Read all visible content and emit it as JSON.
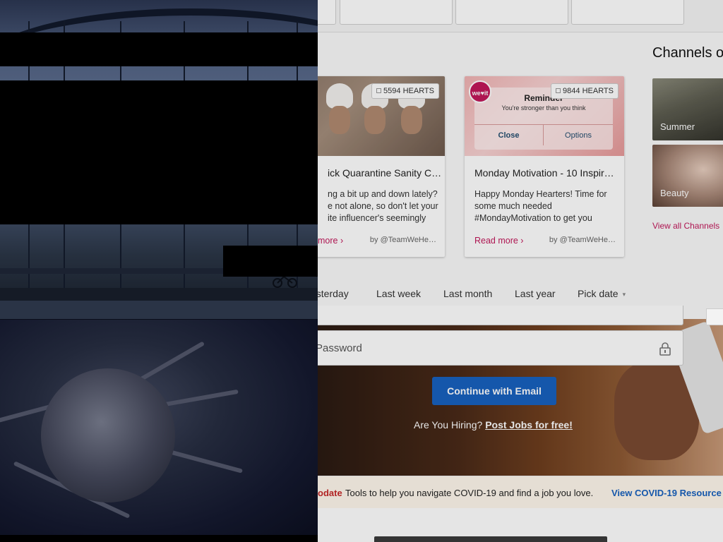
{
  "channels": {
    "title": "Channels o",
    "tiles": [
      {
        "label": "Summer"
      },
      {
        "label": "Beauty"
      }
    ],
    "view_all": "View all Channels"
  },
  "cards": [
    {
      "hearts": "5594 HEARTS",
      "title": "ick Quarantine Sanity C…",
      "text": "ng a bit up and down lately? e not alone, so don't let your ite influencer's seemingly",
      "read_more": "more ›",
      "author": "by @TeamWeHe…"
    },
    {
      "hearts": "9844 HEARTS",
      "title": "Monday Motivation - 10 Inspir…",
      "text": "Happy Monday Hearters! Time for some much needed #MondayMotivation to get you",
      "read_more": "Read more ›",
      "author": "by @TeamWeHe…",
      "reminder": {
        "logo": "we♥it",
        "title": "Reminder",
        "subtitle": "You're stronger than you think",
        "close": "Close",
        "options": "Options"
      }
    }
  ],
  "date_filter": {
    "options": [
      "esterday",
      "Last week",
      "Last month",
      "Last year",
      "Pick date"
    ],
    "pick_arrow": "▾"
  },
  "login": {
    "password_placeholder": "Password",
    "continue_label": "Continue with Email",
    "hiring_text": "Are You Hiring?",
    "post_jobs_link": "Post Jobs for free!"
  },
  "covid": {
    "update_label": "odate",
    "text": "Tools to help you navigate COVID-19 and find a job you love.",
    "link": "View COVID-19 Resource"
  }
}
